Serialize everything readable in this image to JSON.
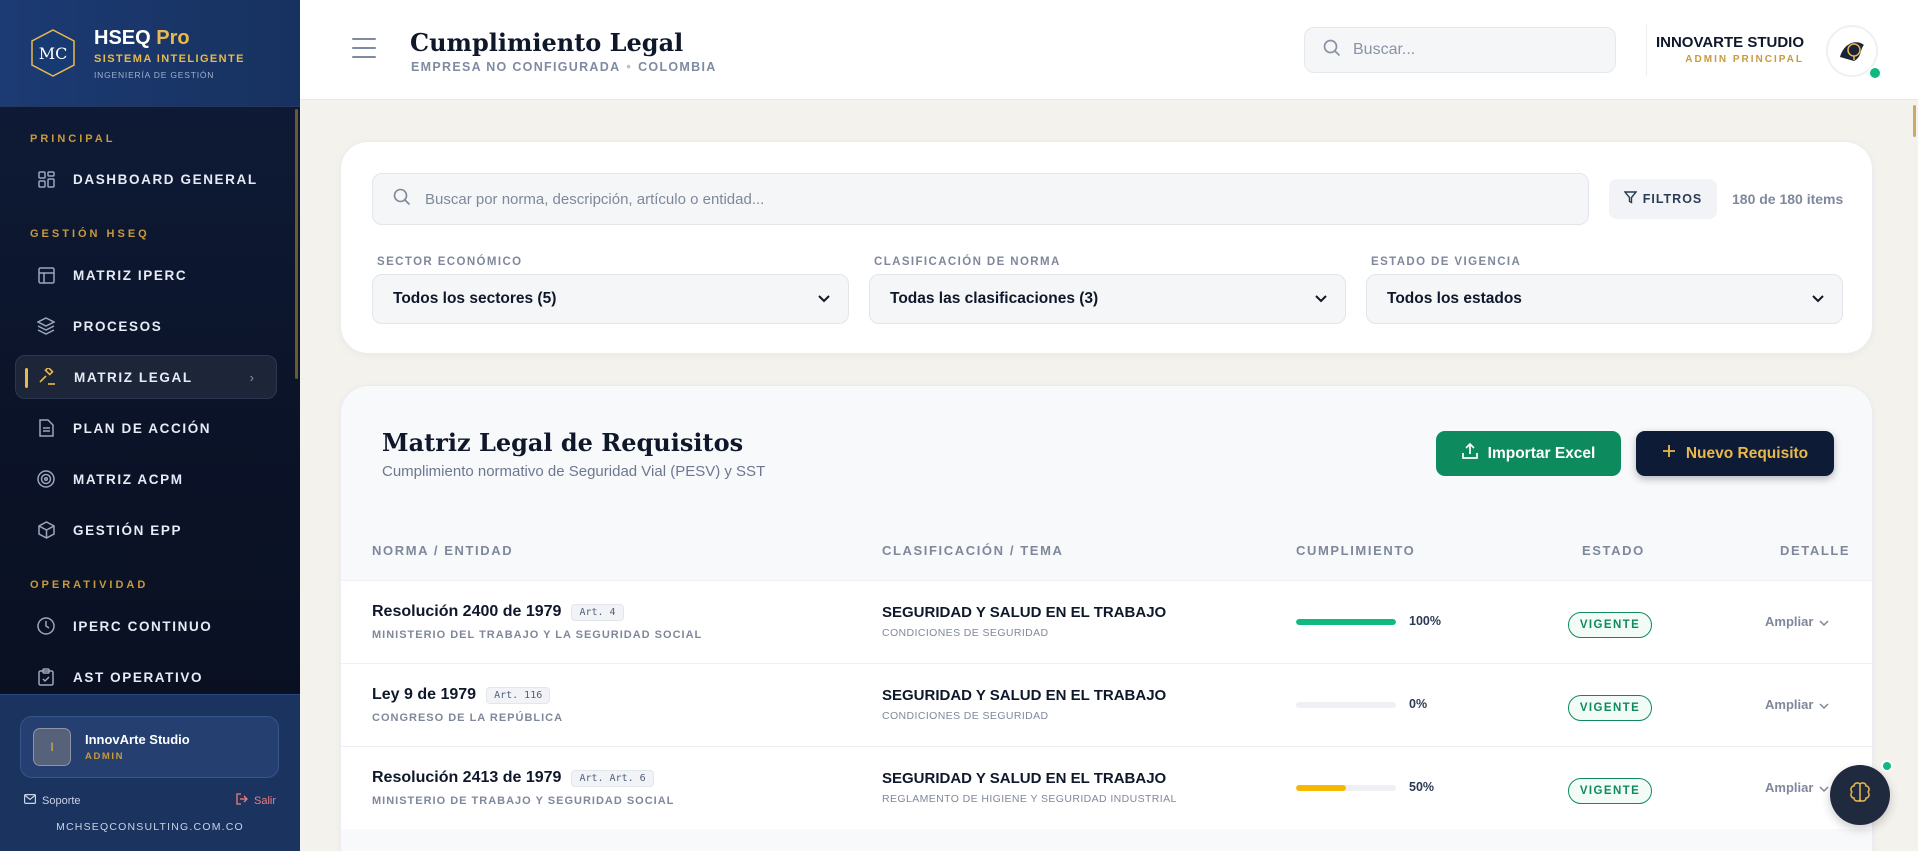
{
  "brand": {
    "logo_text": "MC",
    "name": "HSEQ",
    "name_accent": "Pro",
    "tagline": "SISTEMA INTELIGENTE",
    "subtagline": "INGENIERÍA DE GESTIÓN"
  },
  "sidebar": {
    "sections": [
      {
        "title": "PRINCIPAL"
      },
      {
        "title": "GESTIÓN HSEQ"
      },
      {
        "title": "OPERATIVIDAD"
      }
    ],
    "items": [
      {
        "label": "DASHBOARD GENERAL",
        "icon": "grid-icon"
      },
      {
        "label": "MATRIZ IPERC",
        "icon": "table-icon"
      },
      {
        "label": "PROCESOS",
        "icon": "layers-icon"
      },
      {
        "label": "MATRIZ LEGAL",
        "icon": "gavel-icon",
        "active": true
      },
      {
        "label": "PLAN DE ACCIÓN",
        "icon": "document-icon"
      },
      {
        "label": "MATRIZ ACPM",
        "icon": "target-icon"
      },
      {
        "label": "GESTIÓN EPP",
        "icon": "box-icon"
      },
      {
        "label": "IPERC CONTINUO",
        "icon": "clock-icon"
      },
      {
        "label": "AST OPERATIVO",
        "icon": "clipboard-icon"
      }
    ]
  },
  "user": {
    "initial": "I",
    "name": "InnovArte Studio",
    "role": "ADMIN",
    "support_label": "Soporte",
    "exit_label": "Salir",
    "domain": "MCHSEQCONSULTING.COM.CO"
  },
  "header": {
    "title": "Cumplimiento Legal",
    "company": "EMPRESA NO CONFIGURADA",
    "country": "COLOMBIA",
    "search_placeholder": "Buscar...",
    "org_name": "INNOVARTE STUDIO",
    "org_role": "ADMIN PRINCIPAL"
  },
  "filters": {
    "search_placeholder": "Buscar por norma, descripción, artículo o entidad...",
    "filters_label": "FILTROS",
    "count": "180 de 180 items",
    "sector_label": "SECTOR ECONÓMICO",
    "sector_value": "Todos los sectores (5)",
    "clas_label": "CLASIFICACIÓN DE NORMA",
    "clas_value": "Todas las clasificaciones (3)",
    "estado_label": "ESTADO DE VIGENCIA",
    "estado_value": "Todos los estados"
  },
  "matrix": {
    "title": "Matriz Legal de Requisitos",
    "subtitle": "Cumplimiento normativo de Seguridad Vial (PESV) y SST",
    "import_label": "Importar Excel",
    "new_label": "Nuevo Requisito",
    "columns": {
      "norma": "NORMA / ENTIDAD",
      "clasificacion": "CLASIFICACIÓN / TEMA",
      "cumplimiento": "CUMPLIMIENTO",
      "estado": "ESTADO",
      "detalle": "DETALLE"
    },
    "rows": [
      {
        "norma": "Resolución 2400 de 1979",
        "art": "Art. 4",
        "entidad": "MINISTERIO DEL TRABAJO Y LA SEGURIDAD SOCIAL",
        "clasificacion": "SEGURIDAD Y SALUD EN EL TRABAJO",
        "tema": "CONDICIONES DE SEGURIDAD",
        "cumplimiento": 100,
        "cumplimiento_label": "100%",
        "bar_color": "#10b981",
        "estado": "VIGENTE",
        "detalle": "Ampliar"
      },
      {
        "norma": "Ley 9 de 1979",
        "art": "Art. 116",
        "entidad": "CONGRESO DE LA REPÚBLICA",
        "clasificacion": "SEGURIDAD Y SALUD EN EL TRABAJO",
        "tema": "CONDICIONES DE SEGURIDAD",
        "cumplimiento": 0,
        "cumplimiento_label": "0%",
        "bar_color": "#10b981",
        "estado": "VIGENTE",
        "detalle": "Ampliar"
      },
      {
        "norma": "Resolución 2413 de 1979",
        "art": "Art. Art. 6",
        "entidad": "MINISTERIO DE TRABAJO Y SEGURIDAD SOCIAL",
        "clasificacion": "SEGURIDAD Y SALUD EN EL TRABAJO",
        "tema": "REGLAMENTO DE HIGIENE Y SEGURIDAD INDUSTRIAL",
        "cumplimiento": 50,
        "cumplimiento_label": "50%",
        "bar_color": "#f5b700",
        "estado": "VIGENTE",
        "detalle": "Ampliar"
      }
    ]
  }
}
